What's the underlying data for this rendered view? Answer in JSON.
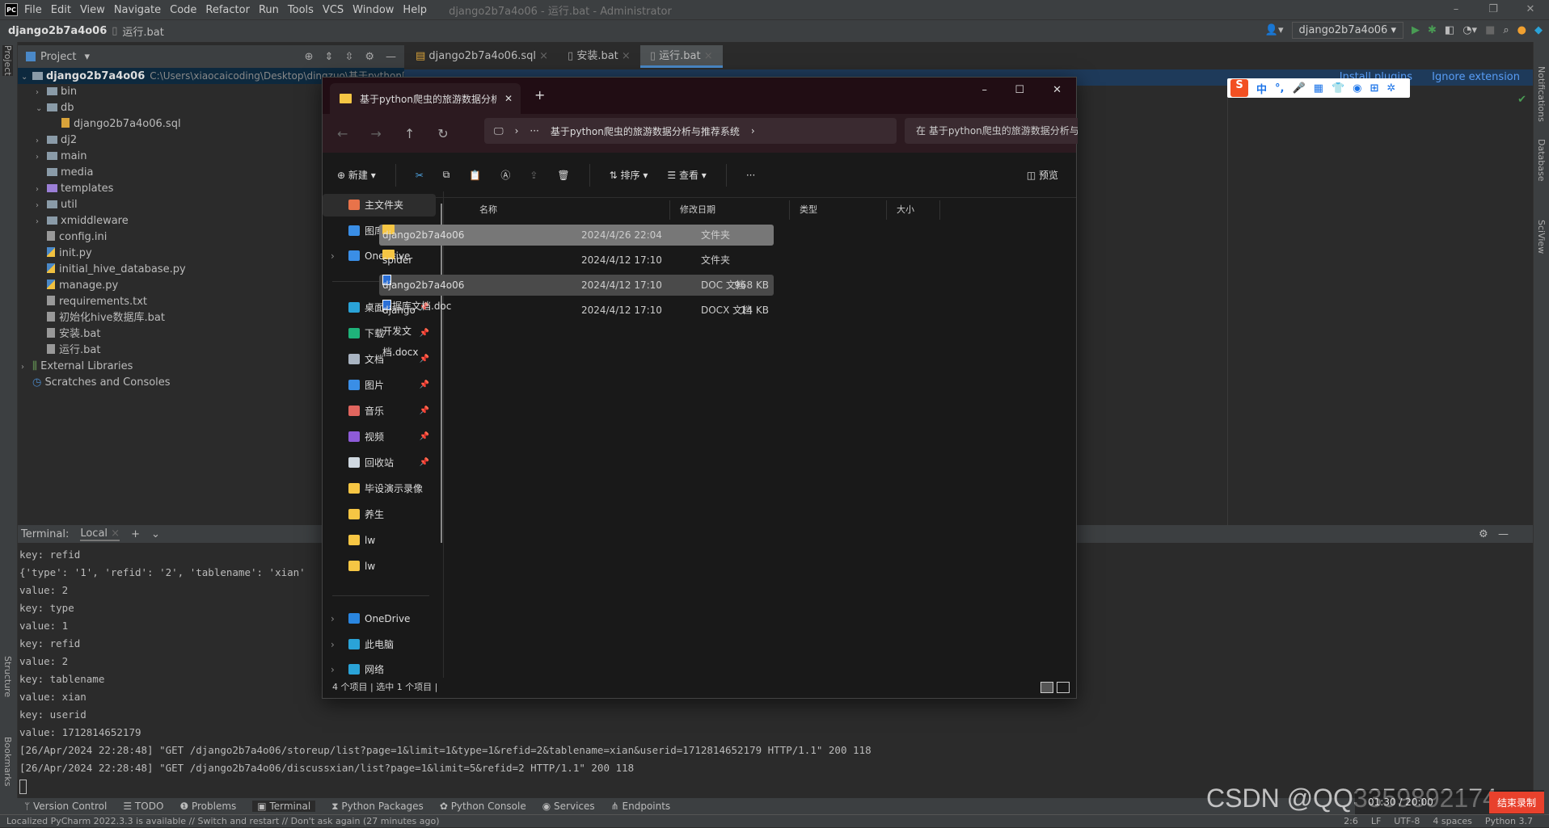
{
  "ide": {
    "window_title": "django2b7a4o06 - 运行.bat - Administrator",
    "menu": [
      "File",
      "Edit",
      "View",
      "Navigate",
      "Code",
      "Refactor",
      "Run",
      "Tools",
      "VCS",
      "Window",
      "Help"
    ],
    "breadcrumb": {
      "project": "django2b7a4o06",
      "file": "运行.bat"
    },
    "run_config": "django2b7a4o06",
    "project_panel": {
      "title": "Project"
    },
    "editor_tabs": [
      "django2b7a4o06.sql",
      "安装.bat",
      "运行.bat"
    ],
    "active_tab": "运行.bat",
    "tree": [
      {
        "label": "django2b7a4o06",
        "path": "C:\\Users\\xiaocaicoding\\Desktop\\dingzuo\\基于python爬虫",
        "depth": 0,
        "type": "folder",
        "expanded": true
      },
      {
        "label": "bin",
        "depth": 1,
        "type": "folder"
      },
      {
        "label": "db",
        "depth": 1,
        "type": "folder",
        "expanded": true
      },
      {
        "label": "django2b7a4o06.sql",
        "depth": 2,
        "type": "sql"
      },
      {
        "label": "dj2",
        "depth": 1,
        "type": "folder"
      },
      {
        "label": "main",
        "depth": 1,
        "type": "folder"
      },
      {
        "label": "media",
        "depth": 1,
        "type": "folder",
        "leaf": true
      },
      {
        "label": "templates",
        "depth": 1,
        "type": "folder-purple"
      },
      {
        "label": "util",
        "depth": 1,
        "type": "folder"
      },
      {
        "label": "xmiddleware",
        "depth": 1,
        "type": "folder"
      },
      {
        "label": "config.ini",
        "depth": 1,
        "type": "file"
      },
      {
        "label": "init.py",
        "depth": 1,
        "type": "py"
      },
      {
        "label": "initial_hive_database.py",
        "depth": 1,
        "type": "py"
      },
      {
        "label": "manage.py",
        "depth": 1,
        "type": "py"
      },
      {
        "label": "requirements.txt",
        "depth": 1,
        "type": "file"
      },
      {
        "label": "初始化hive数据库.bat",
        "depth": 1,
        "type": "file"
      },
      {
        "label": "安装.bat",
        "depth": 1,
        "type": "file"
      },
      {
        "label": "运行.bat",
        "depth": 1,
        "type": "file"
      },
      {
        "label": "External Libraries",
        "depth": 0,
        "type": "lib"
      },
      {
        "label": "Scratches and Consoles",
        "depth": 0,
        "type": "scratch",
        "leaf": true
      }
    ],
    "notification": {
      "install": "Install plugins",
      "ignore": "Ignore extension"
    },
    "right_strip": [
      "Notifications",
      "Database",
      "SciView"
    ],
    "left_strip": [
      "Project",
      "Structure",
      "Bookmarks"
    ],
    "terminal": {
      "label": "Terminal:",
      "tab": "Local",
      "lines": [
        "key: refid",
        "{'type': '1', 'refid': '2', 'tablename': 'xian'",
        "value: 2",
        "key: type",
        "value: 1",
        "key: refid",
        "value: 2",
        "key: tablename",
        "value: xian",
        "key: userid",
        "value: 1712814652179",
        "[26/Apr/2024 22:28:48] \"GET /django2b7a4o06/storeup/list?page=1&limit=1&type=1&refid=2&tablename=xian&userid=1712814652179 HTTP/1.1\" 200 118",
        "[26/Apr/2024 22:28:48] \"GET /django2b7a4o06/discussxian/list?page=1&limit=5&refid=2 HTTP/1.1\" 200 118"
      ]
    },
    "tool_windows": [
      "Version Control",
      "TODO",
      "Problems",
      "Terminal",
      "Python Packages",
      "Python Console",
      "Services",
      "Endpoints"
    ],
    "active_tool": "Terminal",
    "status_message": "Localized PyCharm 2022.3.3 is available // Switch and restart // Don't ask again (27 minutes ago)",
    "status_right": [
      "2:6",
      "LF",
      "UTF-8",
      "4 spaces",
      "Python 3.7"
    ]
  },
  "explorer": {
    "tab_title": "基于python爬虫的旅游数据分析",
    "address": "基于python爬虫的旅游数据分析与推荐系统",
    "search_placeholder": "在 基于python爬虫的旅游数据分析与推荐系统 中搜索",
    "toolbar": {
      "new": "新建",
      "sort": "排序",
      "view": "查看",
      "more": "···",
      "preview": "预览"
    },
    "sidebar": [
      {
        "label": "主文件夹",
        "color": "#e8734a",
        "selected": true
      },
      {
        "label": "图库",
        "color": "#3a8ee6"
      },
      {
        "label": "OneDrive",
        "color": "#3a8ee6",
        "chevron": true
      },
      {
        "label": "桌面",
        "color": "#2aa3d8",
        "pin": true
      },
      {
        "label": "下载",
        "color": "#1fb37a",
        "pin": true
      },
      {
        "label": "文档",
        "color": "#a9b4c2",
        "pin": true
      },
      {
        "label": "图片",
        "color": "#3a8ee6",
        "pin": true
      },
      {
        "label": "音乐",
        "color": "#e0655e",
        "pin": true
      },
      {
        "label": "视频",
        "color": "#8e5bd8",
        "pin": true
      },
      {
        "label": "回收站",
        "color": "#cfd8e0",
        "pin": true
      },
      {
        "label": "毕设演示录像",
        "color": "#f6c644"
      },
      {
        "label": "养生",
        "color": "#f6c644"
      },
      {
        "label": "lw",
        "color": "#f6c644"
      },
      {
        "label": "lw",
        "color": "#f6c644"
      },
      {
        "label": "OneDrive",
        "color": "#2a86e0",
        "chevron": true
      },
      {
        "label": "此电脑",
        "color": "#2aa3d8",
        "chevron": true
      },
      {
        "label": "网络",
        "color": "#2aa3d8",
        "chevron": true
      }
    ],
    "columns": [
      "名称",
      "修改日期",
      "类型",
      "大小"
    ],
    "files": [
      {
        "name": "django2b7a4o06",
        "date": "2024/4/26 22:04",
        "type": "文件夹",
        "size": "",
        "kind": "folder",
        "state": "selected"
      },
      {
        "name": "spider",
        "date": "2024/4/12 17:10",
        "type": "文件夹",
        "size": "",
        "kind": "folder"
      },
      {
        "name": "django2b7a4o06数据库文档.doc",
        "date": "2024/4/12 17:10",
        "type": "DOC 文档",
        "size": "968 KB",
        "kind": "doc",
        "state": "hover"
      },
      {
        "name": "django开发文档.docx",
        "date": "2024/4/12 17:10",
        "type": "DOCX 文档",
        "size": "14 KB",
        "kind": "doc"
      }
    ],
    "status": "4 个项目  |  选中 1 个项目  |"
  },
  "ime_bar": {
    "logo": "S",
    "mode": "中",
    "punct": "°,"
  },
  "watermark": "CSDN @QQ3359892174",
  "recording": {
    "time": "01:30 / 20:00",
    "stop": "结束录制"
  }
}
